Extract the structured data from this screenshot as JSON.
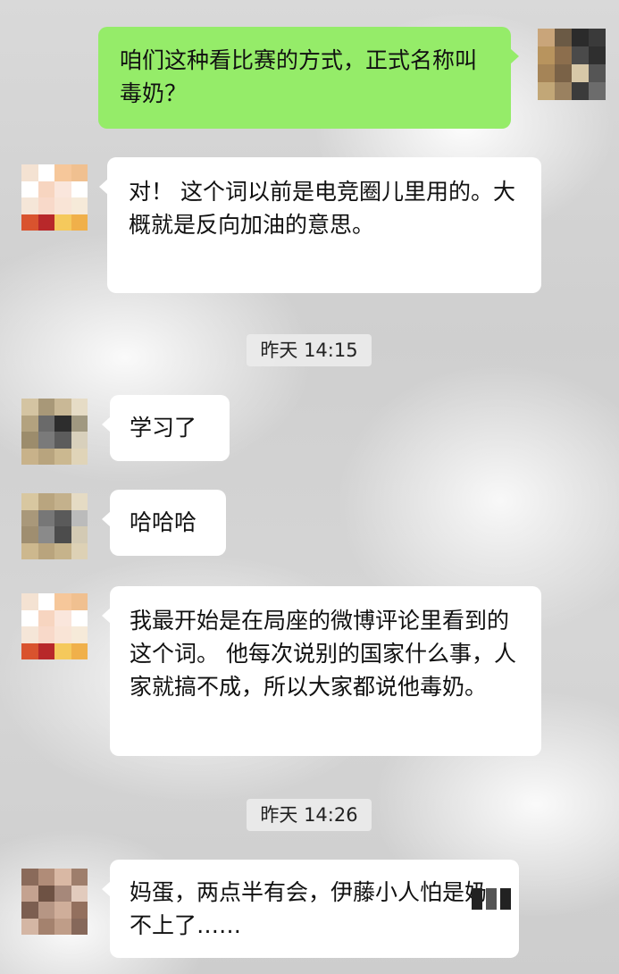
{
  "messages": [
    {
      "side": "out",
      "text": "咱们这种看比赛的方式，正式名称叫毒奶？"
    },
    {
      "side": "in",
      "text": "对！ 这个词以前是电竞圈儿里用的。大概就是反向加油的意思。"
    },
    {
      "side": "time",
      "text": "昨天 14:15"
    },
    {
      "side": "in",
      "text": "学习了"
    },
    {
      "side": "in",
      "text": "哈哈哈"
    },
    {
      "side": "in",
      "text": "我最开始是在局座的微博评论里看到的这个词。 他每次说别的国家什么事，人家就搞不成，所以大家都说他毒奶。"
    },
    {
      "side": "time",
      "text": "昨天 14:26"
    },
    {
      "side": "in",
      "text": "妈蛋，两点半有会，伊藤小人怕是奶不上了……"
    }
  ],
  "colors": {
    "outgoing_bubble": "#95ec69",
    "incoming_bubble": "#ffffff"
  }
}
